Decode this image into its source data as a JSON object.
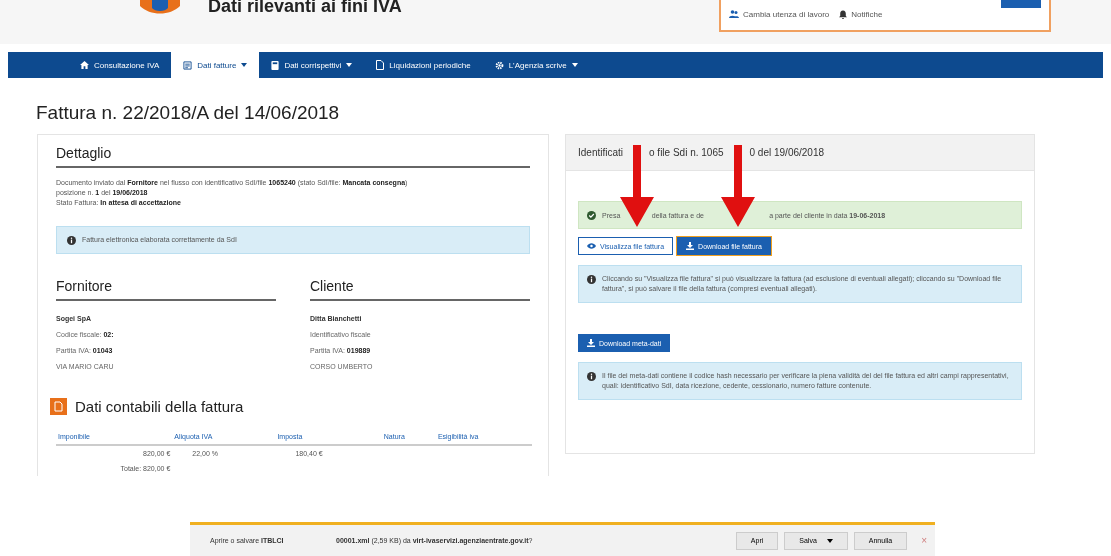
{
  "header": {
    "title": "Dati rilevanti ai fini IVA",
    "links": [
      {
        "label": "Cambia utenza di lavoro"
      },
      {
        "label": "Notifiche"
      }
    ]
  },
  "nav": [
    {
      "label": "Consultazione IVA",
      "dropdown": false,
      "selected": false
    },
    {
      "label": "Dati fatture",
      "dropdown": true,
      "selected": true
    },
    {
      "label": "Dati corrispettivi",
      "dropdown": true,
      "selected": false
    },
    {
      "label": "Liquidazioni periodiche",
      "dropdown": false,
      "selected": false
    },
    {
      "label": "L'Agenzia scrive",
      "dropdown": true,
      "selected": false
    }
  ],
  "page_title": "Fattura n. 22/2018/A del 14/06/2018",
  "detail": {
    "title": "Dettaglio",
    "lines": [
      "Documento inviato dal **Fornitore** nel flusso con identificativo SdI/file **1065240** (stato SdI/file: **Mancata consegna**)",
      "posizione n. **1** del **19/06/2018**",
      "Stato Fattura: **In attesa di accettazione**"
    ],
    "alert": "Fattura elettronica elaborata correttamente da SdI"
  },
  "parties": [
    {
      "title": "Fornitore",
      "name": "Sogei SpA",
      "lines": [
        "Codice fiscale: **02:**",
        "Partita IVA: **01043**",
        "VIA MARIO CARU"
      ]
    },
    {
      "title": "Cliente",
      "name": "Ditta Bianchetti",
      "lines": [
        "Identificativo fiscale",
        "Partita IVA: **019889**",
        "CORSO UMBERTO"
      ]
    }
  ],
  "accounting": {
    "title": "Dati contabili della fattura",
    "columns": [
      "Imponibile",
      "Aliquota IVA",
      "Imposta",
      "Natura",
      "Esigibilità iva"
    ],
    "rows": [
      [
        "820,00 €",
        "22,00 %",
        "180,40 €"
      ]
    ],
    "total": "Totale: 820,00 €"
  },
  "sdi": {
    "title": [
      "Identificati",
      "o file Sdi n. 1065",
      "0 del 19/06/2018"
    ],
    "success": [
      "Presa",
      "della fattura e de",
      "a parte del cliente in data **19-06-2018**"
    ],
    "buttons": [
      {
        "label": "Visualizza file fattura",
        "kind": "outline"
      },
      {
        "label": "Download file fattura",
        "kind": "primary"
      }
    ],
    "info": "Cliccando su \"Visualizza file fattura\" si può visualizzare la fattura (ad esclusione di eventuali allegati); cliccando su \"Download file fattura\", si può salvare il file della fattura (compresi eventuali allegati).",
    "meta_button": "Download meta-dati",
    "meta_info": "Il file dei meta-dati contiene il codice hash necessario per verificare la piena validità del del file fattura ed altri campi rappresentativi, quali: identificativo SdI, data ricezione, cedente, cessionario, numero fatture contenute."
  },
  "download_bar": {
    "prompt": "Aprire o salvare **ITBLCI**",
    "file": "**00001.xml** (2,59 KB) da **virt-ivaservizi.agenziaentrate.gov.it**?",
    "buttons": [
      {
        "label": "Apri",
        "split": false
      },
      {
        "label": "Salva",
        "split": true
      },
      {
        "label": "Annulla",
        "split": false
      }
    ],
    "close": "×"
  }
}
